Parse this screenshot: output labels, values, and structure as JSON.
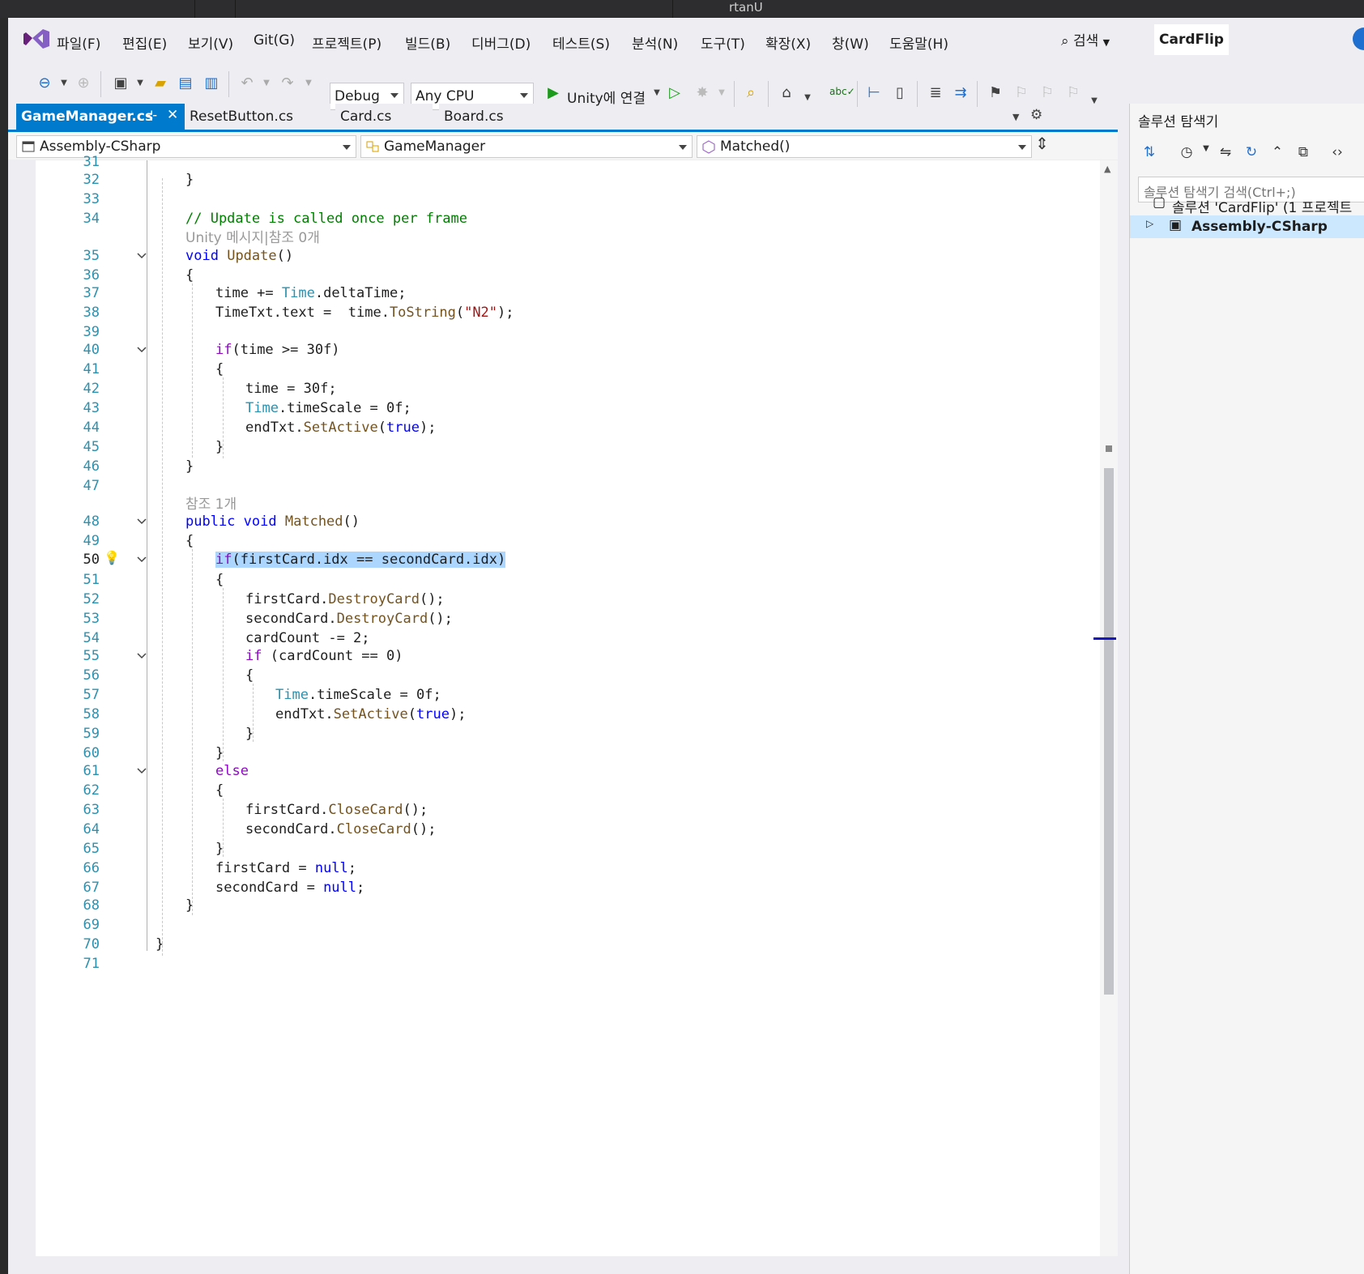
{
  "window_title_strip": {
    "label": "rtanU"
  },
  "menu": {
    "items": [
      "파일(F)",
      "편집(E)",
      "보기(V)",
      "Git(G)",
      "프로젝트(P)",
      "빌드(B)",
      "디버그(D)",
      "테스트(S)",
      "분석(N)",
      "도구(T)",
      "확장(X)",
      "창(W)",
      "도움말(H)"
    ],
    "search_label": "검색",
    "project_name": "CardFlip"
  },
  "toolbar": {
    "config": "Debug",
    "platform": "Any CPU",
    "run_target": "Unity에 연결"
  },
  "tabs": [
    {
      "label": "GameManager.cs",
      "active": true
    },
    {
      "label": "ResetButton.cs",
      "active": false
    },
    {
      "label": "Card.cs",
      "active": false
    },
    {
      "label": "Board.cs",
      "active": false
    }
  ],
  "navbar": {
    "project": "Assembly-CSharp",
    "class": "GameManager",
    "member": "Matched()"
  },
  "editor": {
    "current_line": 50,
    "selection_text": "if(firstCard.idx == secondCard.idx)",
    "hints": {
      "update_hint": "Unity 메시지|참조 0개",
      "matched_hint": "참조 1개"
    },
    "lines": [
      {
        "n": "31",
        "text": ""
      },
      {
        "n": "32",
        "text": "}"
      },
      {
        "n": "33",
        "text": ""
      },
      {
        "n": "34",
        "text": "// Update is called once per frame"
      },
      {
        "n": "35",
        "text": "void Update()"
      },
      {
        "n": "36",
        "text": "{"
      },
      {
        "n": "37",
        "text": "time += Time.deltaTime;"
      },
      {
        "n": "38",
        "text": "TimeTxt.text =  time.ToString(\"N2\");"
      },
      {
        "n": "39",
        "text": ""
      },
      {
        "n": "40",
        "text": "if(time >= 30f)"
      },
      {
        "n": "41",
        "text": "{"
      },
      {
        "n": "42",
        "text": "time = 30f;"
      },
      {
        "n": "43",
        "text": "Time.timeScale = 0f;"
      },
      {
        "n": "44",
        "text": "endTxt.SetActive(true);"
      },
      {
        "n": "45",
        "text": "}"
      },
      {
        "n": "46",
        "text": "}"
      },
      {
        "n": "47",
        "text": ""
      },
      {
        "n": "48",
        "text": "public void Matched()"
      },
      {
        "n": "49",
        "text": "{"
      },
      {
        "n": "50",
        "text": "if(firstCard.idx == secondCard.idx)"
      },
      {
        "n": "51",
        "text": "{"
      },
      {
        "n": "52",
        "text": "firstCard.DestroyCard();"
      },
      {
        "n": "53",
        "text": "secondCard.DestroyCard();"
      },
      {
        "n": "54",
        "text": "cardCount -= 2;"
      },
      {
        "n": "55",
        "text": "if (cardCount == 0)"
      },
      {
        "n": "56",
        "text": "{"
      },
      {
        "n": "57",
        "text": "Time.timeScale = 0f;"
      },
      {
        "n": "58",
        "text": "endTxt.SetActive(true);"
      },
      {
        "n": "59",
        "text": "}"
      },
      {
        "n": "60",
        "text": "}"
      },
      {
        "n": "61",
        "text": "else"
      },
      {
        "n": "62",
        "text": "{"
      },
      {
        "n": "63",
        "text": "firstCard.CloseCard();"
      },
      {
        "n": "64",
        "text": "secondCard.CloseCard();"
      },
      {
        "n": "65",
        "text": "}"
      },
      {
        "n": "66",
        "text": "firstCard = null;"
      },
      {
        "n": "67",
        "text": "secondCard = null;"
      },
      {
        "n": "68",
        "text": "}"
      },
      {
        "n": "69",
        "text": ""
      },
      {
        "n": "70",
        "text": "}"
      },
      {
        "n": "71",
        "text": ""
      }
    ]
  },
  "solution_explorer": {
    "title": "솔루션 탐색기",
    "search_placeholder": "솔루션 탐색기 검색(Ctrl+;)",
    "solution_label": "솔루션 'CardFlip' (1 프로젝트",
    "project_label": "Assembly-CSharp"
  },
  "colors": {
    "accent": "#007acc",
    "keyword": "#0000ff",
    "control_keyword": "#8f08c4",
    "comment": "#008000",
    "type": "#2b91af",
    "method": "#74531f",
    "string": "#a31515",
    "selection": "#add6ff"
  }
}
